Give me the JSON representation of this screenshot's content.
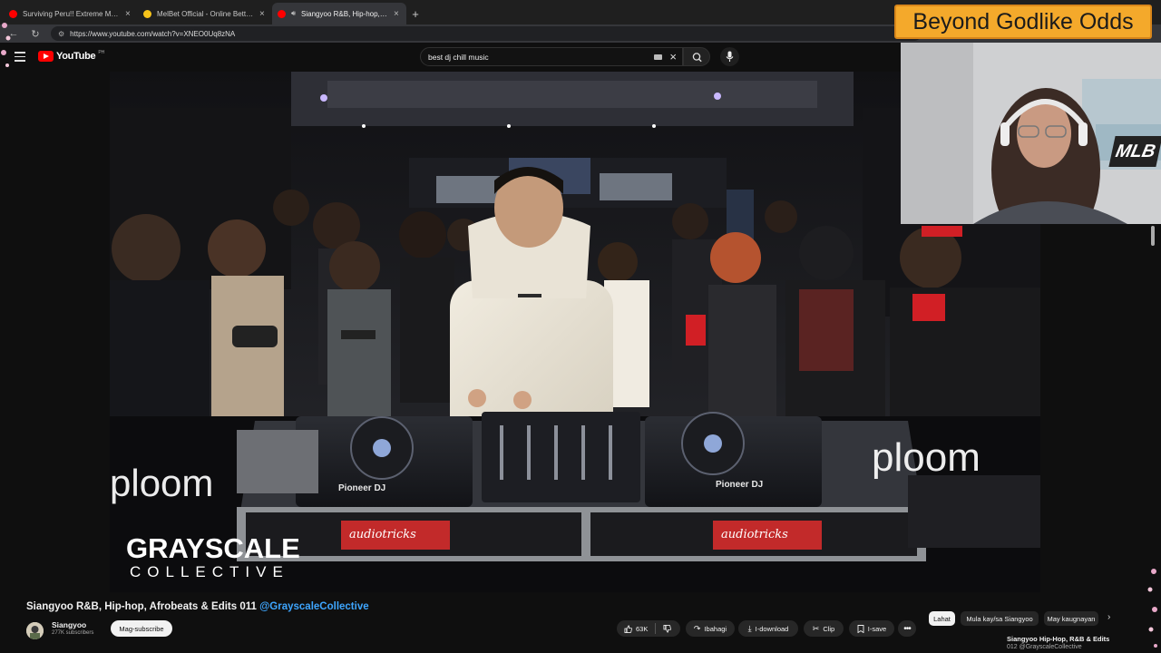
{
  "browser": {
    "tabs": [
      {
        "title": "Surviving Peru!! Extreme Meats In",
        "favicon_color": "#ff0000",
        "active": false
      },
      {
        "title": "MelBet Official - Online Betting W",
        "favicon_color": "#f6c31a",
        "active": false
      },
      {
        "title": "Siangyoo R&B, Hip-hop, Afro",
        "favicon_color": "#ff0000",
        "active": true
      }
    ],
    "url": "https://www.youtube.com/watch?v=XNEO0Uq8zNA"
  },
  "youtube": {
    "logo_text": "YouTube",
    "logo_region": "PH",
    "search_value": "best dj chill music"
  },
  "overlay": {
    "banner_text": "Beyond Godlike Odds",
    "badge_text": "MLB"
  },
  "video_frame": {
    "floor_logo": "ploom",
    "deck_brand": "Pioneer DJ",
    "case_brand": "audiotricks",
    "watermark_line1": "GRAYSCALE",
    "watermark_line2": "COLLECTIVE"
  },
  "video": {
    "title": "Siangyoo R&B, Hip-hop, Afrobeats & Edits 011",
    "title_tag": "@GrayscaleCollective",
    "channel": "Siangyoo",
    "subscribers": "277K subscribers",
    "subscribe_label": "Mag-subscribe",
    "like_count": "63K",
    "share_label": "Ibahagi",
    "download_label": "I-download",
    "clip_label": "Clip",
    "save_label": "I-save"
  },
  "recommendations": {
    "chips": [
      "Lahat",
      "Mula kay/sa Siangyoo",
      "May kaugnayan"
    ],
    "first_title": "Siangyoo Hip-Hop, R&B & Edits",
    "first_meta": "012 @GrayscaleCollective"
  }
}
